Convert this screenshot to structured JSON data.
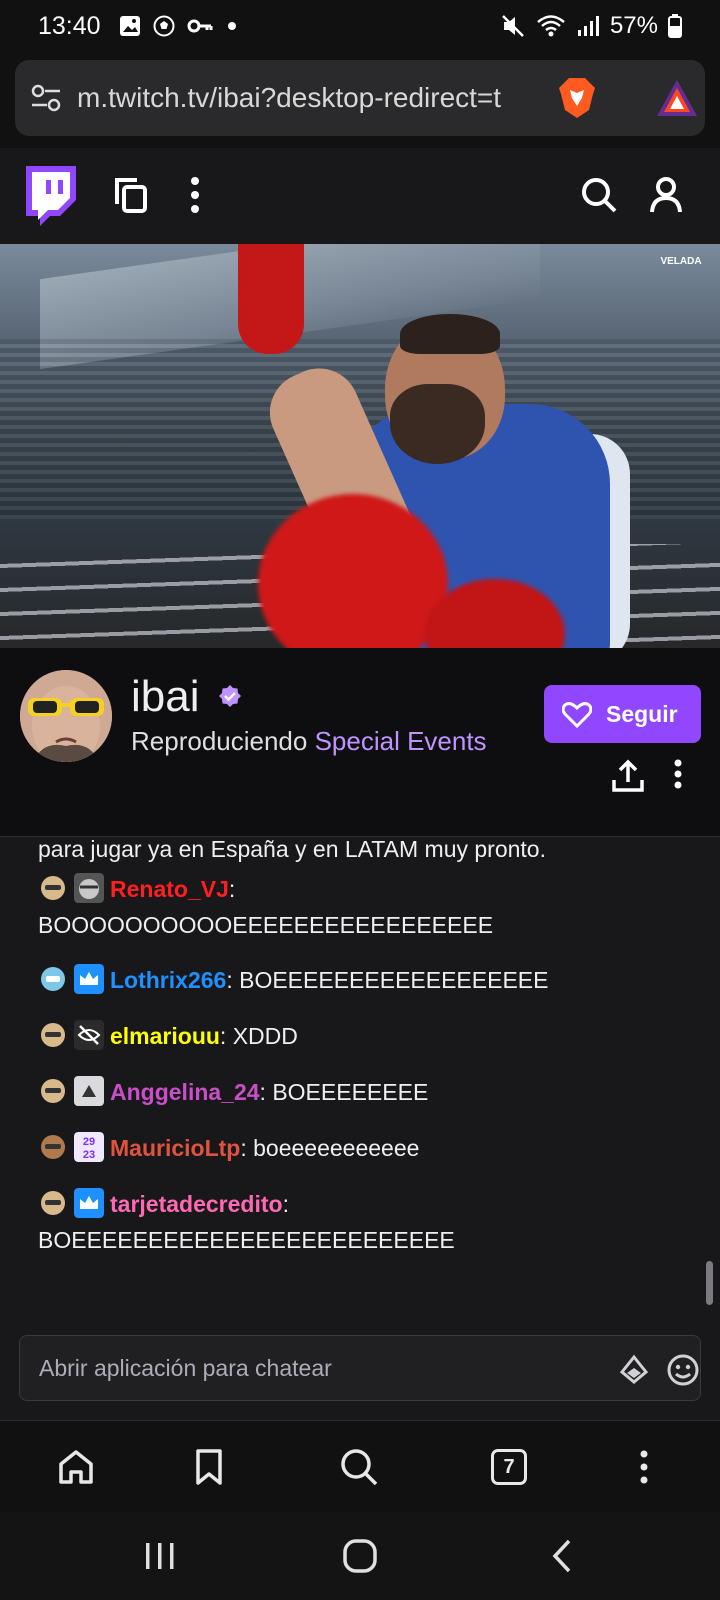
{
  "status_bar": {
    "time": "13:40",
    "battery": "57%"
  },
  "browser": {
    "url": "m.twitch.tv/ibai?desktop-redirect=t",
    "tab_count": "7"
  },
  "channel": {
    "name": "ibai",
    "playing_prefix": "Reproduciendo ",
    "game": "Special Events",
    "follow_label": "Seguir"
  },
  "video": {
    "overlay_logo": "VELADA"
  },
  "chat": {
    "partial_line": "para jugar ya en España y en LATAM muy pronto.",
    "messages": [
      {
        "user": "Renato_VJ",
        "color": "#ff1f1f",
        "text": "BOOOOOOOOOOEEEEEEEEEEEEEEEEE",
        "badges": [
          "bald-emote-icon",
          "helmet-badge-icon"
        ]
      },
      {
        "user": "Lothrix266",
        "color": "#1e90ff",
        "text": "BOEEEEEEEEEEEEEEEEEE",
        "badges": [
          "robot-emote-icon",
          "crown-badge-icon"
        ]
      },
      {
        "user": "elmariouu",
        "color": "#ffff00",
        "text": "XDDD",
        "badges": [
          "bald-emote-icon",
          "no-audio-badge-icon"
        ]
      },
      {
        "user": "Anggelina_24",
        "color": "#c94fc9",
        "text": "BOEEEEEEEE",
        "badges": [
          "bald-emote-icon",
          "triangle-badge-icon"
        ]
      },
      {
        "user": "MauricioLtp",
        "color": "#e0533d",
        "text": "boeeeeeeeeeee",
        "badges": [
          "tan-emote-icon",
          "2023-badge-icon"
        ]
      },
      {
        "user": "tarjetadecredito",
        "color": "#ff69b4",
        "text": "BOEEEEEEEEEEEEEEEEEEEEEEEEE",
        "badges": [
          "bald-emote-icon",
          "crown-badge-icon"
        ]
      }
    ],
    "input_placeholder": "Abrir aplicación para chatear"
  },
  "colors": {
    "twitch_purple": "#9147ff",
    "game_link": "#bf94ff"
  }
}
